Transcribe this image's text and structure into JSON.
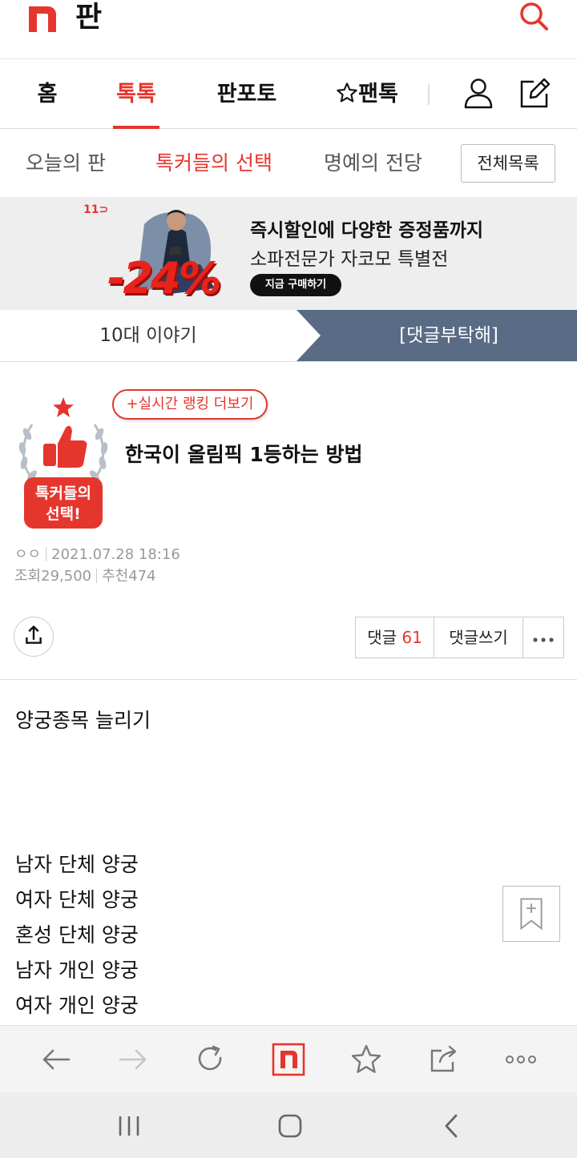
{
  "header": {
    "logo_letter": "n",
    "site_title": "판"
  },
  "main_nav": {
    "tabs": [
      {
        "label": "홈"
      },
      {
        "label": "톡톡"
      },
      {
        "label": "판포토"
      },
      {
        "label": "팬톡"
      }
    ],
    "active_tab": "톡톡"
  },
  "sub_nav": {
    "tabs": [
      {
        "label": "오늘의 판"
      },
      {
        "label": "톡커들의 선택"
      },
      {
        "label": "명예의 전당"
      }
    ],
    "active_tab": "톡커들의 선택",
    "all_list_label": "전체목록"
  },
  "ad": {
    "brand": "11",
    "discount": "-24%",
    "headline": "즉시할인에 다양한 증정품까지",
    "subline": "소파전문가 자코모 특별전",
    "cta": "지금 구매하기"
  },
  "category_strip": {
    "left": "10대 이야기",
    "right": "[댓글부탁해]"
  },
  "article": {
    "badge_text_line1": "톡커들의",
    "badge_text_line2": "선택!",
    "ranking_button": "+실시간 랭킹 더보기",
    "title": "한국이 올림픽 1등하는 방법",
    "author": "ㅇㅇ",
    "datetime": "2021.07.28 18:16",
    "views_label": "조회",
    "views": "29,500",
    "likes_label": "추천",
    "likes": "474",
    "comments_label": "댓글",
    "comments_count": "61",
    "write_comment_label": "댓글쓰기",
    "body_lines": [
      "양궁종목 늘리기",
      "남자 단체 양궁",
      "여자 단체 양궁",
      "혼성 단체 양궁",
      "남자 개인 양궁",
      "여자 개인 양궁"
    ]
  },
  "colors": {
    "accent": "#e5362e",
    "strip_blue": "#5a6b85"
  }
}
